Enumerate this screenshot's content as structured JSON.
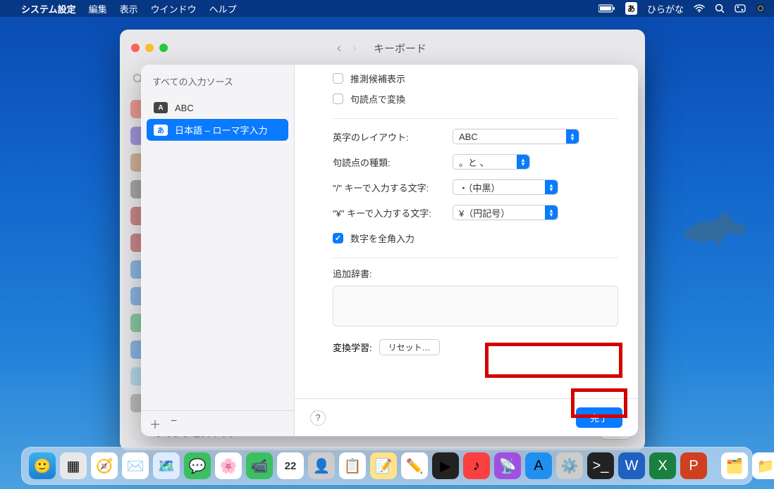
{
  "menubar": {
    "app": "システム設定",
    "items": [
      "編集",
      "表示",
      "ウインドウ",
      "ヘルプ"
    ],
    "ime_badge": "あ",
    "ime_label": "ひらがな"
  },
  "background_window": {
    "title": "キーボード",
    "footer_text": "プリンタとスキャナ",
    "footer_button": "…"
  },
  "sheet": {
    "header": "すべての入力ソース",
    "sources": [
      {
        "badge": "A",
        "label": "ABC",
        "selected": false
      },
      {
        "badge": "あ",
        "label": "日本語 – ローマ字入力",
        "selected": true
      }
    ],
    "checks": {
      "predict": "推測候補表示",
      "punct_convert": "句読点で変換",
      "fullwidth_digits": "数字を全角入力"
    },
    "rows": {
      "layout": {
        "label": "英字のレイアウト:",
        "value": "ABC"
      },
      "punct": {
        "label": "句読点の種類:",
        "value": "。と 、"
      },
      "slash": {
        "label": "\"/\" キーで入力する文字:",
        "value": "・（中黒）"
      },
      "yen": {
        "label": "\"¥\" キーで入力する文字:",
        "value": "¥（円記号）"
      }
    },
    "dict_label": "追加辞書:",
    "learning_label": "変換学習:",
    "reset_button": "リセット…",
    "help": "?",
    "done": "完了"
  },
  "dock": {
    "date": "22"
  }
}
